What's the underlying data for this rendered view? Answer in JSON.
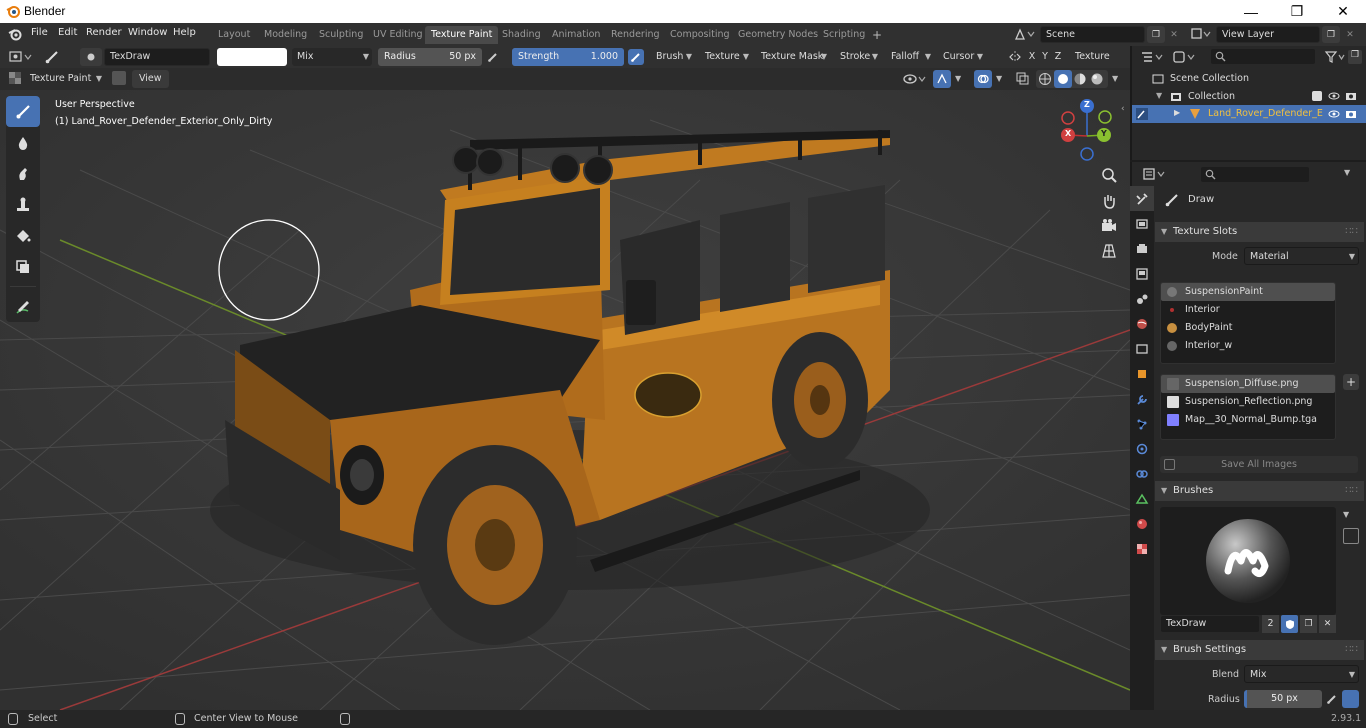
{
  "window": {
    "title": "Blender",
    "minimize": "—",
    "maximize": "❐",
    "close": "✕"
  },
  "menu": [
    "File",
    "Edit",
    "Render",
    "Window",
    "Help"
  ],
  "workspaces": [
    "Layout",
    "Modeling",
    "Sculpting",
    "UV Editing",
    "Texture Paint",
    "Shading",
    "Animation",
    "Rendering",
    "Compositing",
    "Geometry Nodes",
    "Scripting"
  ],
  "active_workspace": "Texture Paint",
  "add_workspace": "+",
  "scene": {
    "name": "Scene",
    "view_layer": "View Layer"
  },
  "tool_header": {
    "brush_name": "TexDraw",
    "blend": "Mix",
    "radius_label": "Radius",
    "radius_value": "50 px",
    "strength_label": "Strength",
    "strength_value": "1.000",
    "strength_fraction": 1.0,
    "dropdowns": [
      "Brush",
      "Texture",
      "Texture Mask",
      "Stroke",
      "Falloff",
      "Cursor"
    ],
    "axes": [
      "X",
      "Y",
      "Z"
    ],
    "texture_slots": "Texture Slots"
  },
  "header2": {
    "mode": "Texture Paint",
    "view": "View"
  },
  "viewport": {
    "perspective": "User Perspective",
    "object_label": "(1) Land_Rover_Defender_Exterior_Only_Dirty",
    "gizmo": {
      "x": "X",
      "y": "Y",
      "z": "Z"
    },
    "background": "#3a3a3a",
    "car_color": "#c27a1c"
  },
  "outliner": {
    "search_placeholder": "",
    "root": "Scene Collection",
    "collection": "Collection",
    "object": "Land_Rover_Defender_E"
  },
  "properties": {
    "search_placeholder": "",
    "tool_title": "Draw",
    "texture_slots": {
      "header": "Texture Slots",
      "mode_label": "Mode",
      "mode_value": "Material",
      "materials": [
        {
          "name": "SuspensionPaint",
          "color": "#777777"
        },
        {
          "name": "Interior",
          "color": "#b03030"
        },
        {
          "name": "BodyPaint",
          "color": "#c89040"
        },
        {
          "name": "Interior_w",
          "color": "#666666"
        }
      ],
      "images": [
        {
          "name": "Suspension_Diffuse.png",
          "color": "#666666"
        },
        {
          "name": "Suspension_Reflection.png",
          "color": "#dddddd"
        },
        {
          "name": "Map__30_Normal_Bump.tga",
          "color": "#8080ff"
        }
      ],
      "save_all": "Save All Images"
    },
    "brushes": {
      "header": "Brushes",
      "name": "TexDraw",
      "users": "2"
    },
    "brush_settings": {
      "header": "Brush Settings",
      "blend_label": "Blend",
      "blend_value": "Mix",
      "radius_label": "Radius",
      "radius_value": "50 px"
    }
  },
  "status": {
    "select": "Select",
    "center": "Center View to Mouse",
    "version": "2.93.1"
  }
}
